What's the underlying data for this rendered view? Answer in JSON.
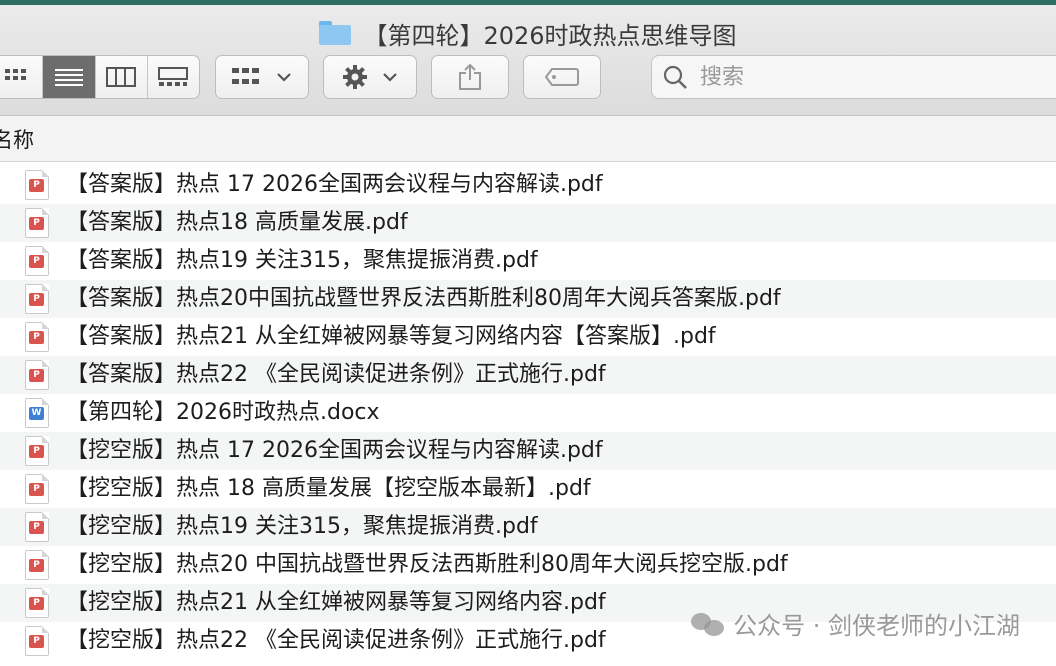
{
  "window": {
    "title": "【第四轮】2026时政热点思维导图"
  },
  "toolbar": {
    "view_icons": [
      "icon-view-icon",
      "list-view-icon",
      "column-view-icon",
      "gallery-view-icon"
    ],
    "search_placeholder": "搜索"
  },
  "columns": {
    "name": "名称"
  },
  "files": [
    {
      "name": "【答案版】热点 17 2026全国两会议程与内容解读.pdf",
      "type": "pdf"
    },
    {
      "name": "【答案版】热点18 高质量发展.pdf",
      "type": "pdf"
    },
    {
      "name": "【答案版】热点19 关注315，聚焦提振消费.pdf",
      "type": "pdf"
    },
    {
      "name": "【答案版】热点20中国抗战暨世界反法西斯胜利80周年大阅兵答案版.pdf",
      "type": "pdf"
    },
    {
      "name": "【答案版】热点21 从全红婵被网暴等复习网络内容【答案版】.pdf",
      "type": "pdf"
    },
    {
      "name": "【答案版】热点22 《全民阅读促进条例》正式施行.pdf",
      "type": "pdf"
    },
    {
      "name": "【第四轮】2026时政热点.docx",
      "type": "docx"
    },
    {
      "name": "【挖空版】热点 17 2026全国两会议程与内容解读.pdf",
      "type": "pdf"
    },
    {
      "name": "【挖空版】热点 18 高质量发展【挖空版本最新】.pdf",
      "type": "pdf"
    },
    {
      "name": "【挖空版】热点19 关注315，聚焦提振消费.pdf",
      "type": "pdf"
    },
    {
      "name": "【挖空版】热点20 中国抗战暨世界反法西斯胜利80周年大阅兵挖空版.pdf",
      "type": "pdf"
    },
    {
      "name": "【挖空版】热点21 从全红婵被网暴等复习网络内容.pdf",
      "type": "pdf"
    },
    {
      "name": "【挖空版】热点22 《全民阅读促进条例》正式施行.pdf",
      "type": "pdf"
    }
  ],
  "watermark": {
    "text": "公众号 · 剑侠老师的小江湖"
  }
}
